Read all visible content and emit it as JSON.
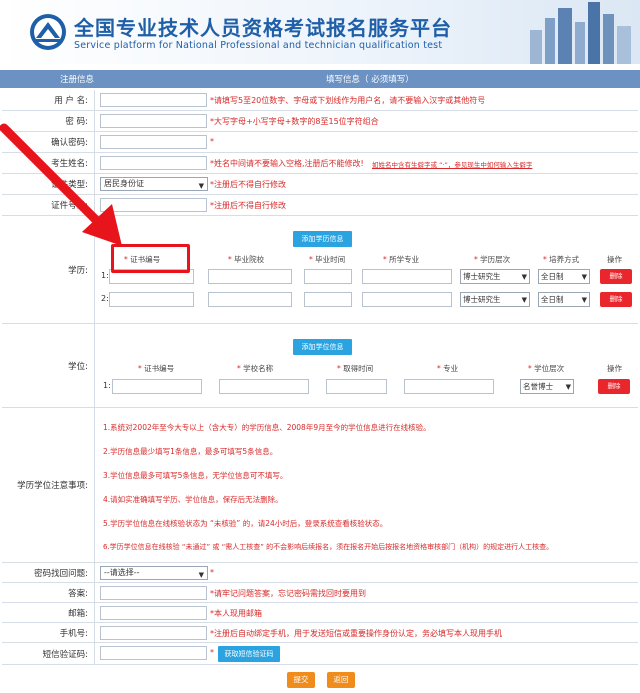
{
  "header": {
    "title_cn": "全国专业技术人员资格考试报名服务平台",
    "title_en": "Service platform for National Professional and technician  qualification test"
  },
  "table_header": {
    "left": "注册信息",
    "right": "填写信息（ 必须填写）"
  },
  "form": {
    "username": {
      "label": "用 户 名:",
      "hint": "*请填写5至20位数字、字母或下划线作为用户名，请不要输入汉字或其他符号"
    },
    "password": {
      "label": "密     码:",
      "hint": "*大写字母+小写字母+数字的8至15位字符组合"
    },
    "confirm": {
      "label": "确认密码:",
      "hint": "*"
    },
    "name": {
      "label": "考生姓名:",
      "hint": "*姓名中间请不要输入空格,注册后不能修改!",
      "hint_extra": "如姓名中含有生僻字或 “·”，参见现生中如何输入生僻字"
    },
    "id_type": {
      "label": "证件类型:",
      "value": "居民身份证",
      "hint": "*注册后不得自行修改"
    },
    "id_number": {
      "label": "证件号码:",
      "hint": "*注册后不得自行修改"
    }
  },
  "education": {
    "label": "学历:",
    "add_button": "添加学历信息",
    "columns": [
      "证书编号",
      "毕业院校",
      "毕业时间",
      "所学专业",
      "学历层次",
      "培养方式",
      "操作"
    ],
    "rows": [
      {
        "num": "1:",
        "level": "博士研究生",
        "mode": "全日制",
        "delete": "删除"
      },
      {
        "num": "2:",
        "level": "博士研究生",
        "mode": "全日制",
        "delete": "删除"
      }
    ]
  },
  "degree": {
    "label": "学位:",
    "add_button": "添加学位信息",
    "columns": [
      "证书编号",
      "学校名称",
      "取得时间",
      "专业",
      "学位层次",
      "操作"
    ],
    "rows": [
      {
        "num": "1:",
        "level": "名誉博士",
        "delete": "删除"
      }
    ]
  },
  "notes": {
    "label": "学历学位注意事项:",
    "items": [
      "1.系统对2002年至今大专以上（含大专）的学历信息、2008年9月至今的学位信息进行在线核验。",
      "2.学历信息最少填写1条信息，最多可填写5条信息。",
      "3.学位信息最多可填写5条信息，无学位信息可不填写。",
      "4.请如实准确填写学历、学位信息，保存后无法删除。",
      "5.学历学位信息在线核验状态为 “未核验” 的，请24小时后，登录系统查看核验状态。",
      "6.学历学位信息在线核验 “未通过” 或 “需人工核查” 的不会影响后续报名，须在报名开始后按报名地资格审核部门（机构）的规定进行人工核查。"
    ]
  },
  "security": {
    "question": {
      "label": "密码找回问题:",
      "value": "--请选择--",
      "hint": "*"
    },
    "answer": {
      "label": "答案:",
      "hint": "*请牢记问题答案，忘记密码需找回时要用到"
    },
    "email": {
      "label": "邮箱:",
      "hint": "*本人现用邮箱"
    },
    "phone": {
      "label": "手机号:",
      "hint": "*注册后自动绑定手机，用于发送短信或重要操作身份认定，务必填写本人现用手机"
    },
    "sms": {
      "label": "短信验证码:",
      "hint": "*",
      "button": "获取短信验证码"
    }
  },
  "actions": {
    "submit": "提交",
    "back": "返回"
  },
  "colors": {
    "accent_blue": "#2aa3e0",
    "header_bar": "#6b92c3",
    "danger": "#e8262b",
    "orange": "#f08c1c",
    "annotation": "#e8141b"
  }
}
